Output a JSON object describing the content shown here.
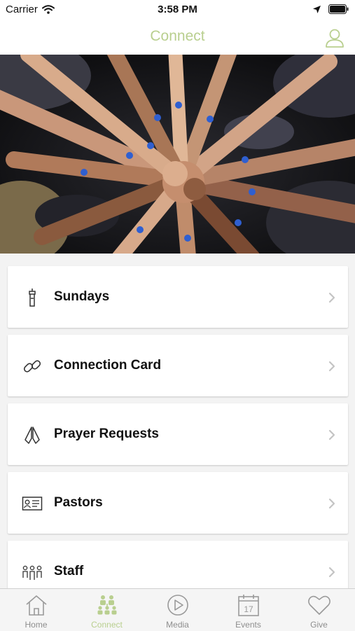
{
  "status_bar": {
    "carrier": "Carrier",
    "time": "3:58 PM"
  },
  "header": {
    "title": "Connect"
  },
  "menu": [
    {
      "label": "Sundays",
      "icon": "podium-icon"
    },
    {
      "label": "Connection Card",
      "icon": "link-icon"
    },
    {
      "label": "Prayer Requests",
      "icon": "praying-hands-icon"
    },
    {
      "label": "Pastors",
      "icon": "id-card-icon"
    },
    {
      "label": "Staff",
      "icon": "people-icon"
    }
  ],
  "tabs": [
    {
      "label": "Home",
      "icon": "home-icon",
      "active": false
    },
    {
      "label": "Connect",
      "icon": "connect-people-icon",
      "active": true
    },
    {
      "label": "Media",
      "icon": "play-icon",
      "active": false
    },
    {
      "label": "Events",
      "icon": "calendar-icon",
      "active": false,
      "calendar_day": "17"
    },
    {
      "label": "Give",
      "icon": "heart-icon",
      "active": false
    }
  ],
  "colors": {
    "accent": "#b9cf8f",
    "tab_inactive": "#8e8e8e",
    "hero_dark": "#141416"
  }
}
